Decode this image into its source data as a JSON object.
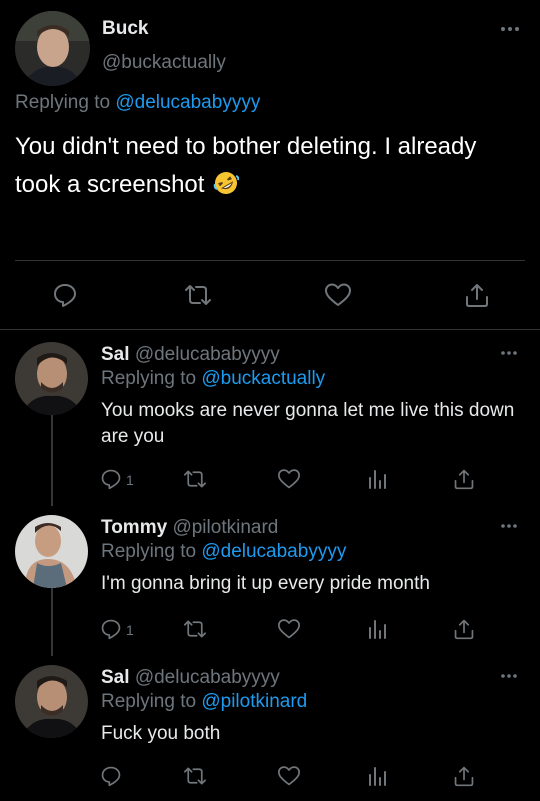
{
  "main_tweet": {
    "display_name": "Buck",
    "handle": "@buckactually",
    "replying_prefix": "Replying to",
    "replying_to": "@delucababyyyy",
    "text": "You didn't need to bother deleting. I already took a screenshot",
    "emoji": "rolling-on-floor-laughing-emoji"
  },
  "replies": [
    {
      "display_name": "Sal",
      "handle": "@delucababyyyy",
      "replying_prefix": "Replying to",
      "replying_to": "@buckactually",
      "text": "You mooks are never gonna let me live this down are you",
      "reply_count": "1"
    },
    {
      "display_name": "Tommy",
      "handle": "@pilotkinard",
      "replying_prefix": "Replying to",
      "replying_to": "@delucababyyyy",
      "text": "I'm gonna bring it up every pride month",
      "reply_count": "1"
    },
    {
      "display_name": "Sal",
      "handle": "@delucababyyyy",
      "replying_prefix": "Replying to",
      "replying_to": "@pilotkinard",
      "text": "Fuck you both",
      "reply_count": ""
    }
  ],
  "colors": {
    "background": "#000000",
    "text": "#e7e9ea",
    "muted": "#6e767d",
    "link": "#1d9bf0",
    "divider": "#2f3336"
  }
}
